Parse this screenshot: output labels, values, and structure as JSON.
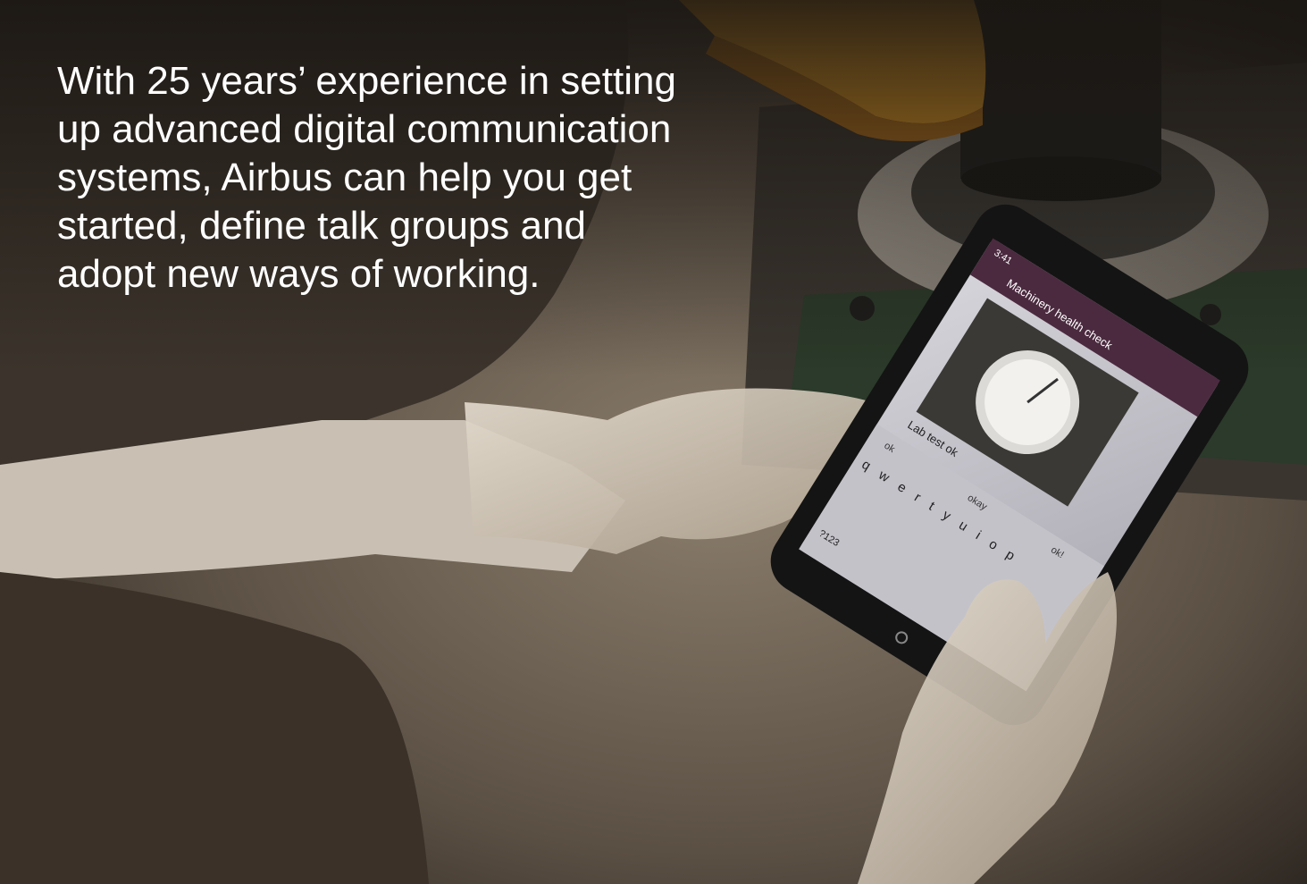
{
  "caption": {
    "lines": [
      "With 25 years’ experience in setting",
      "up advanced digital communication",
      "systems, Airbus can help you get",
      "started, define talk groups and",
      "adopt new ways of working."
    ]
  },
  "photo": {
    "subject": "gloved-hands-holding-rugged-phone",
    "phone_screen": {
      "status_time": "3:41",
      "chat_title": "Machinery health check",
      "message": "Lab test ok",
      "suggestions": [
        "ok",
        "okay",
        "ok!"
      ],
      "keyboard_row": "qwertyuiop",
      "keyboard_mode_key": "?123"
    }
  },
  "colors": {
    "caption_text": "#ffffff",
    "app_bar": "#4b2a3f",
    "safety_hat": "#f0a325"
  }
}
